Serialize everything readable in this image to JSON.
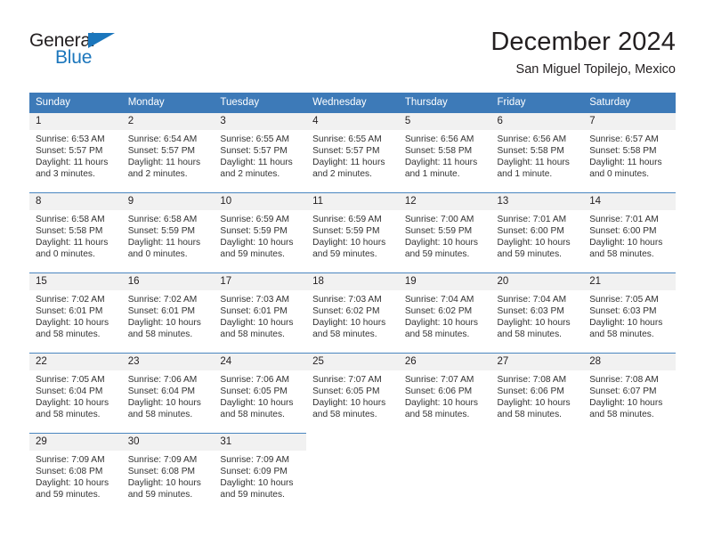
{
  "brand": {
    "name_part1": "General",
    "name_part2": "Blue",
    "triangle_color": "#1b76bc"
  },
  "header": {
    "title": "December 2024",
    "subtitle": "San Miguel Topilejo, Mexico"
  },
  "colors": {
    "header_blue": "#3d7ab8",
    "row_divider": "#4a86c0",
    "daynum_band": "#f1f1f1",
    "text": "#231f20"
  },
  "weekday_headers": [
    "Sunday",
    "Monday",
    "Tuesday",
    "Wednesday",
    "Thursday",
    "Friday",
    "Saturday"
  ],
  "weeks": [
    [
      {
        "day": "1",
        "sunrise": "Sunrise: 6:53 AM",
        "sunset": "Sunset: 5:57 PM",
        "daylight_line1": "Daylight: 11 hours",
        "daylight_line2": "and 3 minutes."
      },
      {
        "day": "2",
        "sunrise": "Sunrise: 6:54 AM",
        "sunset": "Sunset: 5:57 PM",
        "daylight_line1": "Daylight: 11 hours",
        "daylight_line2": "and 2 minutes."
      },
      {
        "day": "3",
        "sunrise": "Sunrise: 6:55 AM",
        "sunset": "Sunset: 5:57 PM",
        "daylight_line1": "Daylight: 11 hours",
        "daylight_line2": "and 2 minutes."
      },
      {
        "day": "4",
        "sunrise": "Sunrise: 6:55 AM",
        "sunset": "Sunset: 5:57 PM",
        "daylight_line1": "Daylight: 11 hours",
        "daylight_line2": "and 2 minutes."
      },
      {
        "day": "5",
        "sunrise": "Sunrise: 6:56 AM",
        "sunset": "Sunset: 5:58 PM",
        "daylight_line1": "Daylight: 11 hours",
        "daylight_line2": "and 1 minute."
      },
      {
        "day": "6",
        "sunrise": "Sunrise: 6:56 AM",
        "sunset": "Sunset: 5:58 PM",
        "daylight_line1": "Daylight: 11 hours",
        "daylight_line2": "and 1 minute."
      },
      {
        "day": "7",
        "sunrise": "Sunrise: 6:57 AM",
        "sunset": "Sunset: 5:58 PM",
        "daylight_line1": "Daylight: 11 hours",
        "daylight_line2": "and 0 minutes."
      }
    ],
    [
      {
        "day": "8",
        "sunrise": "Sunrise: 6:58 AM",
        "sunset": "Sunset: 5:58 PM",
        "daylight_line1": "Daylight: 11 hours",
        "daylight_line2": "and 0 minutes."
      },
      {
        "day": "9",
        "sunrise": "Sunrise: 6:58 AM",
        "sunset": "Sunset: 5:59 PM",
        "daylight_line1": "Daylight: 11 hours",
        "daylight_line2": "and 0 minutes."
      },
      {
        "day": "10",
        "sunrise": "Sunrise: 6:59 AM",
        "sunset": "Sunset: 5:59 PM",
        "daylight_line1": "Daylight: 10 hours",
        "daylight_line2": "and 59 minutes."
      },
      {
        "day": "11",
        "sunrise": "Sunrise: 6:59 AM",
        "sunset": "Sunset: 5:59 PM",
        "daylight_line1": "Daylight: 10 hours",
        "daylight_line2": "and 59 minutes."
      },
      {
        "day": "12",
        "sunrise": "Sunrise: 7:00 AM",
        "sunset": "Sunset: 5:59 PM",
        "daylight_line1": "Daylight: 10 hours",
        "daylight_line2": "and 59 minutes."
      },
      {
        "day": "13",
        "sunrise": "Sunrise: 7:01 AM",
        "sunset": "Sunset: 6:00 PM",
        "daylight_line1": "Daylight: 10 hours",
        "daylight_line2": "and 59 minutes."
      },
      {
        "day": "14",
        "sunrise": "Sunrise: 7:01 AM",
        "sunset": "Sunset: 6:00 PM",
        "daylight_line1": "Daylight: 10 hours",
        "daylight_line2": "and 58 minutes."
      }
    ],
    [
      {
        "day": "15",
        "sunrise": "Sunrise: 7:02 AM",
        "sunset": "Sunset: 6:01 PM",
        "daylight_line1": "Daylight: 10 hours",
        "daylight_line2": "and 58 minutes."
      },
      {
        "day": "16",
        "sunrise": "Sunrise: 7:02 AM",
        "sunset": "Sunset: 6:01 PM",
        "daylight_line1": "Daylight: 10 hours",
        "daylight_line2": "and 58 minutes."
      },
      {
        "day": "17",
        "sunrise": "Sunrise: 7:03 AM",
        "sunset": "Sunset: 6:01 PM",
        "daylight_line1": "Daylight: 10 hours",
        "daylight_line2": "and 58 minutes."
      },
      {
        "day": "18",
        "sunrise": "Sunrise: 7:03 AM",
        "sunset": "Sunset: 6:02 PM",
        "daylight_line1": "Daylight: 10 hours",
        "daylight_line2": "and 58 minutes."
      },
      {
        "day": "19",
        "sunrise": "Sunrise: 7:04 AM",
        "sunset": "Sunset: 6:02 PM",
        "daylight_line1": "Daylight: 10 hours",
        "daylight_line2": "and 58 minutes."
      },
      {
        "day": "20",
        "sunrise": "Sunrise: 7:04 AM",
        "sunset": "Sunset: 6:03 PM",
        "daylight_line1": "Daylight: 10 hours",
        "daylight_line2": "and 58 minutes."
      },
      {
        "day": "21",
        "sunrise": "Sunrise: 7:05 AM",
        "sunset": "Sunset: 6:03 PM",
        "daylight_line1": "Daylight: 10 hours",
        "daylight_line2": "and 58 minutes."
      }
    ],
    [
      {
        "day": "22",
        "sunrise": "Sunrise: 7:05 AM",
        "sunset": "Sunset: 6:04 PM",
        "daylight_line1": "Daylight: 10 hours",
        "daylight_line2": "and 58 minutes."
      },
      {
        "day": "23",
        "sunrise": "Sunrise: 7:06 AM",
        "sunset": "Sunset: 6:04 PM",
        "daylight_line1": "Daylight: 10 hours",
        "daylight_line2": "and 58 minutes."
      },
      {
        "day": "24",
        "sunrise": "Sunrise: 7:06 AM",
        "sunset": "Sunset: 6:05 PM",
        "daylight_line1": "Daylight: 10 hours",
        "daylight_line2": "and 58 minutes."
      },
      {
        "day": "25",
        "sunrise": "Sunrise: 7:07 AM",
        "sunset": "Sunset: 6:05 PM",
        "daylight_line1": "Daylight: 10 hours",
        "daylight_line2": "and 58 minutes."
      },
      {
        "day": "26",
        "sunrise": "Sunrise: 7:07 AM",
        "sunset": "Sunset: 6:06 PM",
        "daylight_line1": "Daylight: 10 hours",
        "daylight_line2": "and 58 minutes."
      },
      {
        "day": "27",
        "sunrise": "Sunrise: 7:08 AM",
        "sunset": "Sunset: 6:06 PM",
        "daylight_line1": "Daylight: 10 hours",
        "daylight_line2": "and 58 minutes."
      },
      {
        "day": "28",
        "sunrise": "Sunrise: 7:08 AM",
        "sunset": "Sunset: 6:07 PM",
        "daylight_line1": "Daylight: 10 hours",
        "daylight_line2": "and 58 minutes."
      }
    ],
    [
      {
        "day": "29",
        "sunrise": "Sunrise: 7:09 AM",
        "sunset": "Sunset: 6:08 PM",
        "daylight_line1": "Daylight: 10 hours",
        "daylight_line2": "and 59 minutes."
      },
      {
        "day": "30",
        "sunrise": "Sunrise: 7:09 AM",
        "sunset": "Sunset: 6:08 PM",
        "daylight_line1": "Daylight: 10 hours",
        "daylight_line2": "and 59 minutes."
      },
      {
        "day": "31",
        "sunrise": "Sunrise: 7:09 AM",
        "sunset": "Sunset: 6:09 PM",
        "daylight_line1": "Daylight: 10 hours",
        "daylight_line2": "and 59 minutes."
      },
      {
        "day": "",
        "sunrise": "",
        "sunset": "",
        "daylight_line1": "",
        "daylight_line2": ""
      },
      {
        "day": "",
        "sunrise": "",
        "sunset": "",
        "daylight_line1": "",
        "daylight_line2": ""
      },
      {
        "day": "",
        "sunrise": "",
        "sunset": "",
        "daylight_line1": "",
        "daylight_line2": ""
      },
      {
        "day": "",
        "sunrise": "",
        "sunset": "",
        "daylight_line1": "",
        "daylight_line2": ""
      }
    ]
  ]
}
